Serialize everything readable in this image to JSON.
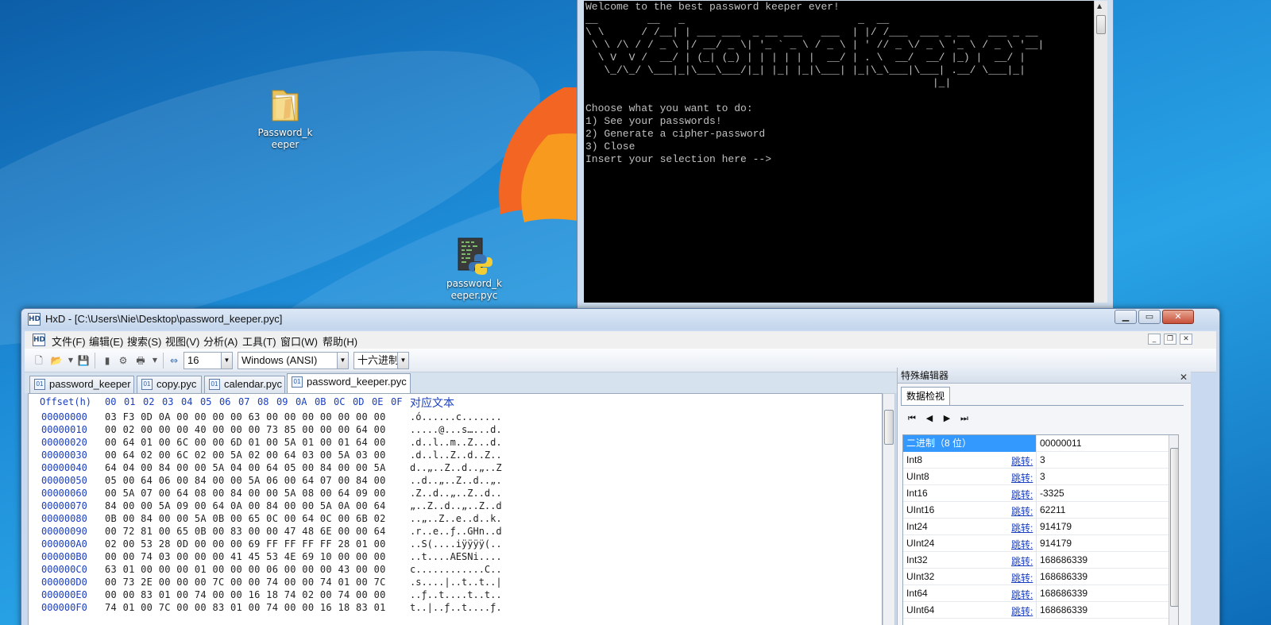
{
  "desktop": {
    "icons": [
      {
        "label_line1": "Password_k",
        "label_line2": "eeper",
        "icon": "folder-icon"
      },
      {
        "label_line1": "password_k",
        "label_line2": "eeper.pyc",
        "icon": "python-file-icon"
      }
    ]
  },
  "console": {
    "lines": [
      "Welcome to the best password keeper ever!",
      "__        __   _                            _  __",
      "\\ \\      / /__| | ___ ___  _ __ ___   ___  | |/ /___  ___ _ __   ___ _ __",
      " \\ \\ /\\ / / _ \\ |/ __/ _ \\| '_ ` _ \\ / _ \\ | ' // _ \\/ _ \\ '_ \\ / _ \\ '__|",
      "  \\ V  V /  __/ | (_| (_) | | | | | |  __/ | . \\  __/  __/ |_) |  __/ |",
      "   \\_/\\_/ \\___|_|\\___\\___/|_| |_| |_|\\___| |_|\\_\\___|\\___| .__/ \\___|_|",
      "                                                        |_|",
      "",
      "Choose what you want to do:",
      "1) See your passwords!",
      "2) Generate a cipher-password",
      "3) Close",
      "Insert your selection here -->"
    ]
  },
  "hxd": {
    "title": "HxD - [C:\\Users\\Nie\\Desktop\\password_keeper.pyc]",
    "menu": [
      "文件(F)",
      "编辑(E)",
      "搜索(S)",
      "视图(V)",
      "分析(A)",
      "工具(T)",
      "窗口(W)",
      "帮助(H)"
    ],
    "toolbar": {
      "bytes_per_row": "16",
      "charset": "Windows (ANSI)",
      "number_base": "十六进制"
    },
    "tabs": [
      "password_keeper",
      "copy.pyc",
      "calendar.pyc",
      "password_keeper.pyc"
    ],
    "active_tab": 3,
    "hex_header": {
      "offset": "Offset(h)",
      "columns": [
        "00",
        "01",
        "02",
        "03",
        "04",
        "05",
        "06",
        "07",
        "08",
        "09",
        "0A",
        "0B",
        "0C",
        "0D",
        "0E",
        "0F"
      ],
      "text": "对应文本"
    },
    "rows": [
      {
        "offset": "00000000",
        "hex": "03 F3 0D 0A 00 00 00 00 63 00 00 00 00 00 00 00",
        "text": ".ó......c......."
      },
      {
        "offset": "00000010",
        "hex": "00 02 00 00 00 40 00 00 00 73 85 00 00 00 64 00",
        "text": ".....@...s…...d."
      },
      {
        "offset": "00000020",
        "hex": "00 64 01 00 6C 00 00 6D 01 00 5A 01 00 01 64 00",
        "text": ".d..l..m..Z...d."
      },
      {
        "offset": "00000030",
        "hex": "00 64 02 00 6C 02 00 5A 02 00 64 03 00 5A 03 00",
        "text": ".d..l..Z..d..Z.."
      },
      {
        "offset": "00000040",
        "hex": "64 04 00 84 00 00 5A 04 00 64 05 00 84 00 00 5A",
        "text": "d..„..Z..d..„..Z"
      },
      {
        "offset": "00000050",
        "hex": "05 00 64 06 00 84 00 00 5A 06 00 64 07 00 84 00",
        "text": "..d..„..Z..d..„."
      },
      {
        "offset": "00000060",
        "hex": "00 5A 07 00 64 08 00 84 00 00 5A 08 00 64 09 00",
        "text": ".Z..d..„..Z..d.."
      },
      {
        "offset": "00000070",
        "hex": "84 00 00 5A 09 00 64 0A 00 84 00 00 5A 0A 00 64",
        "text": "„..Z..d..„..Z..d"
      },
      {
        "offset": "00000080",
        "hex": "0B 00 84 00 00 5A 0B 00 65 0C 00 64 0C 00 6B 02",
        "text": "..„..Z..e..d..k."
      },
      {
        "offset": "00000090",
        "hex": "00 72 81 00 65 0B 00 83 00 00 47 48 6E 00 00 64",
        "text": ".r..e..ƒ..GHn..d"
      },
      {
        "offset": "000000A0",
        "hex": "02 00 53 28 0D 00 00 00 69 FF FF FF FF 28 01 00",
        "text": "..S(....iÿÿÿÿ(.."
      },
      {
        "offset": "000000B0",
        "hex": "00 00 74 03 00 00 00 41 45 53 4E 69 10 00 00 00",
        "text": "..t....AESNi...."
      },
      {
        "offset": "000000C0",
        "hex": "63 01 00 00 00 01 00 00 00 06 00 00 00 43 00 00",
        "text": "c............C.."
      },
      {
        "offset": "000000D0",
        "hex": "00 73 2E 00 00 00 7C 00 00 74 00 00 74 01 00 7C",
        "text": ".s....|..t..t..|"
      },
      {
        "offset": "000000E0",
        "hex": "00 00 83 01 00 74 00 00 16 18 74 02 00 74 00 00",
        "text": "..ƒ..t....t..t.."
      },
      {
        "offset": "000000F0",
        "hex": "74 01 00 7C 00 00 83 01 00 74 00 00 16 18 83 01",
        "text": "t..|..ƒ..t....ƒ."
      }
    ]
  },
  "special_editor": {
    "title": "特殊编辑器",
    "tab": "数据检视",
    "jump_label": "跳转:",
    "rows": [
      {
        "name": "二进制（8 位）",
        "value": "00000011",
        "jump": false,
        "selected": true
      },
      {
        "name": "Int8",
        "value": "3",
        "jump": true
      },
      {
        "name": "UInt8",
        "value": "3",
        "jump": true
      },
      {
        "name": "Int16",
        "value": "-3325",
        "jump": true
      },
      {
        "name": "UInt16",
        "value": "62211",
        "jump": true
      },
      {
        "name": "Int24",
        "value": "914179",
        "jump": true
      },
      {
        "name": "UInt24",
        "value": "914179",
        "jump": true
      },
      {
        "name": "Int32",
        "value": "168686339",
        "jump": true
      },
      {
        "name": "UInt32",
        "value": "168686339",
        "jump": true
      },
      {
        "name": "Int64",
        "value": "168686339",
        "jump": true
      },
      {
        "name": "UInt64",
        "value": "168686339",
        "jump": true
      }
    ]
  }
}
